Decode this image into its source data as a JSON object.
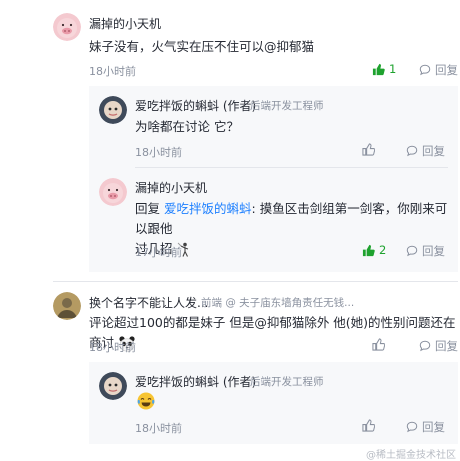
{
  "comments": [
    {
      "author": "漏掉的小天机",
      "text": "妹子没有，火气实在压不住可以@抑郁猫",
      "time": "18小时前",
      "like_count": "1",
      "reply_label": "回复",
      "replies": [
        {
          "author": "爱吃拌饭的蝌蚪",
          "badge": "(作者)",
          "title": "后端开发工程师",
          "text": "为啥都在讨论 它？",
          "time": "18小时前",
          "reply_label": "回复"
        },
        {
          "author": "漏掉的小天机",
          "reply_prefix": "回复",
          "reply_to": "爱吃拌饭的蝌蚪",
          "text_line1": ": 摸鱼区击剑组第一剑客，你刚来可以跟他",
          "text_line2": "过几招",
          "time": "17小时前",
          "like_count": "2",
          "reply_label": "回复"
        }
      ]
    },
    {
      "author": "换个名字不能让人发...",
      "title": "前端 @ 夫子庙东墙角责任无钱...",
      "text": "评论超过100的都是妹子 但是@抑郁猫除外 他(她)的性别问题还在商讨",
      "time": "18小时前",
      "reply_label": "回复",
      "replies": [
        {
          "author": "爱吃拌饭的蝌蚪",
          "badge": "(作者)",
          "title": "后端开发工程师",
          "time": "18小时前",
          "reply_label": "回复"
        }
      ]
    }
  ],
  "watermark": "@稀土掘金技术社区",
  "colors": {
    "accent": "#1e80ff",
    "liked": "#1ea22e",
    "muted": "#8a919f",
    "sub_bg": "#f7f8fa"
  }
}
